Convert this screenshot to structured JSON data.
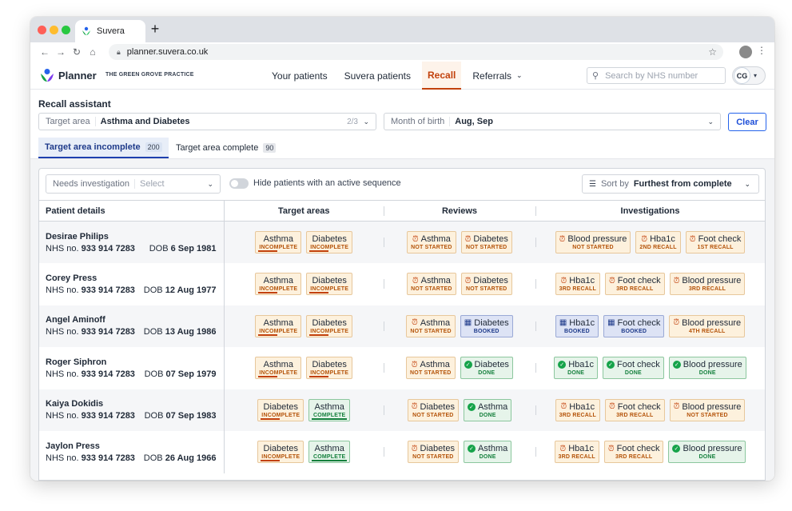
{
  "browser": {
    "tab_title": "Suvera",
    "url": "planner.suvera.co.uk"
  },
  "app": {
    "brand": "Planner",
    "practice": "THE GREEN GROVE PRACTICE",
    "nav": [
      "Your patients",
      "Suvera patients",
      "Recall",
      "Referrals"
    ],
    "active_nav": "Recall",
    "search_placeholder": "Search by NHS number",
    "user_initials": "CG"
  },
  "page": {
    "title": "Recall assistant",
    "target_area": {
      "label": "Target area",
      "value": "Asthma and Diabetes",
      "count": "2/3"
    },
    "month_of_birth": {
      "label": "Month of birth",
      "value": "Aug, Sep"
    },
    "clear_label": "Clear",
    "tabs": [
      {
        "label": "Target area incomplete",
        "count": "200",
        "active": true
      },
      {
        "label": "Target area complete",
        "count": "90",
        "active": false
      }
    ],
    "needs_investigation": {
      "label": "Needs investigation",
      "placeholder": "Select"
    },
    "hide_toggle_label": "Hide patients with an active sequence",
    "sort": {
      "label": "Sort by",
      "value": "Furthest from complete"
    }
  },
  "table": {
    "headers": [
      "Patient details",
      "Target areas",
      "Reviews",
      "Investigations"
    ],
    "nhs_prefix": "NHS no.",
    "dob_prefix": "DOB",
    "rows": [
      {
        "name": "Desirae Philips",
        "nhs": "933 914 7283",
        "dob": "6 Sep 1981",
        "targets": [
          {
            "t": "Asthma",
            "s": "INCOMPLETE",
            "k": "incomplete"
          },
          {
            "t": "Diabetes",
            "s": "INCOMPLETE",
            "k": "incomplete"
          }
        ],
        "reviews": [
          {
            "t": "Asthma",
            "s": "NOT STARTED",
            "k": "pending"
          },
          {
            "t": "Diabetes",
            "s": "NOT STARTED",
            "k": "pending"
          }
        ],
        "investigations": [
          {
            "t": "Blood pressure",
            "s": "NOT STARTED",
            "k": "pending"
          },
          {
            "t": "Hba1c",
            "s": "2ND RECALL",
            "k": "pending"
          },
          {
            "t": "Foot check",
            "s": "1ST RECALL",
            "k": "pending"
          }
        ]
      },
      {
        "name": "Corey Press",
        "nhs": "933 914 7283",
        "dob": "12 Aug 1977",
        "targets": [
          {
            "t": "Asthma",
            "s": "INCOMPLETE",
            "k": "incomplete"
          },
          {
            "t": "Diabetes",
            "s": "INCOMPLETE",
            "k": "incomplete"
          }
        ],
        "reviews": [
          {
            "t": "Asthma",
            "s": "NOT STARTED",
            "k": "pending"
          },
          {
            "t": "Diabetes",
            "s": "NOT STARTED",
            "k": "pending"
          }
        ],
        "investigations": [
          {
            "t": "Hba1c",
            "s": "3RD RECALL",
            "k": "pending"
          },
          {
            "t": "Foot check",
            "s": "3RD RECALL",
            "k": "pending"
          },
          {
            "t": "Blood pressure",
            "s": "3RD RECALL",
            "k": "pending"
          }
        ]
      },
      {
        "name": "Angel Aminoff",
        "nhs": "933 914 7283",
        "dob": "13 Aug 1986",
        "targets": [
          {
            "t": "Asthma",
            "s": "INCOMPLETE",
            "k": "incomplete"
          },
          {
            "t": "Diabetes",
            "s": "INCOMPLETE",
            "k": "incomplete"
          }
        ],
        "reviews": [
          {
            "t": "Asthma",
            "s": "NOT STARTED",
            "k": "pending"
          },
          {
            "t": "Diabetes",
            "s": "BOOKED",
            "k": "booked"
          }
        ],
        "investigations": [
          {
            "t": "Hba1c",
            "s": "BOOKED",
            "k": "booked"
          },
          {
            "t": "Foot check",
            "s": "BOOKED",
            "k": "booked"
          },
          {
            "t": "Blood pressure",
            "s": "4TH RECALL",
            "k": "pending"
          }
        ]
      },
      {
        "name": "Roger Siphron",
        "nhs": "933 914 7283",
        "dob": "07 Sep 1979",
        "targets": [
          {
            "t": "Asthma",
            "s": "INCOMPLETE",
            "k": "incomplete"
          },
          {
            "t": "Diabetes",
            "s": "INCOMPLETE",
            "k": "incomplete"
          }
        ],
        "reviews": [
          {
            "t": "Asthma",
            "s": "NOT STARTED",
            "k": "pending"
          },
          {
            "t": "Diabetes",
            "s": "DONE",
            "k": "done"
          }
        ],
        "investigations": [
          {
            "t": "Hba1c",
            "s": "DONE",
            "k": "done"
          },
          {
            "t": "Foot check",
            "s": "DONE",
            "k": "done"
          },
          {
            "t": "Blood pressure",
            "s": "DONE",
            "k": "done"
          }
        ]
      },
      {
        "name": "Kaiya Dokidis",
        "nhs": "933 914 7283",
        "dob": "07 Sep 1983",
        "targets": [
          {
            "t": "Diabetes",
            "s": "INCOMPLETE",
            "k": "incomplete"
          },
          {
            "t": "Asthma",
            "s": "COMPLETE",
            "k": "complete"
          }
        ],
        "reviews": [
          {
            "t": "Diabetes",
            "s": "NOT STARTED",
            "k": "pending"
          },
          {
            "t": "Asthma",
            "s": "DONE",
            "k": "done"
          }
        ],
        "investigations": [
          {
            "t": "Hba1c",
            "s": "3RD RECALL",
            "k": "pending"
          },
          {
            "t": "Foot check",
            "s": "3RD RECALL",
            "k": "pending"
          },
          {
            "t": "Blood pressure",
            "s": "NOT STARTED",
            "k": "pending"
          }
        ]
      },
      {
        "name": "Jaylon Press",
        "nhs": "933 914 7283",
        "dob": "26 Aug 1966",
        "targets": [
          {
            "t": "Diabetes",
            "s": "INCOMPLETE",
            "k": "incomplete"
          },
          {
            "t": "Asthma",
            "s": "COMPLETE",
            "k": "complete"
          }
        ],
        "reviews": [
          {
            "t": "Diabetes",
            "s": "NOT STARTED",
            "k": "pending"
          },
          {
            "t": "Asthma",
            "s": "DONE",
            "k": "done"
          }
        ],
        "investigations": [
          {
            "t": "Hba1c",
            "s": "3RD RECALL",
            "k": "pending"
          },
          {
            "t": "Foot check",
            "s": "3RD RECALL",
            "k": "pending"
          },
          {
            "t": "Blood pressure",
            "s": "DONE",
            "k": "done"
          }
        ]
      }
    ]
  },
  "icons": {
    "pending": "alarm-clock-icon",
    "booked": "calendar-icon",
    "done": "check-circle-icon"
  }
}
